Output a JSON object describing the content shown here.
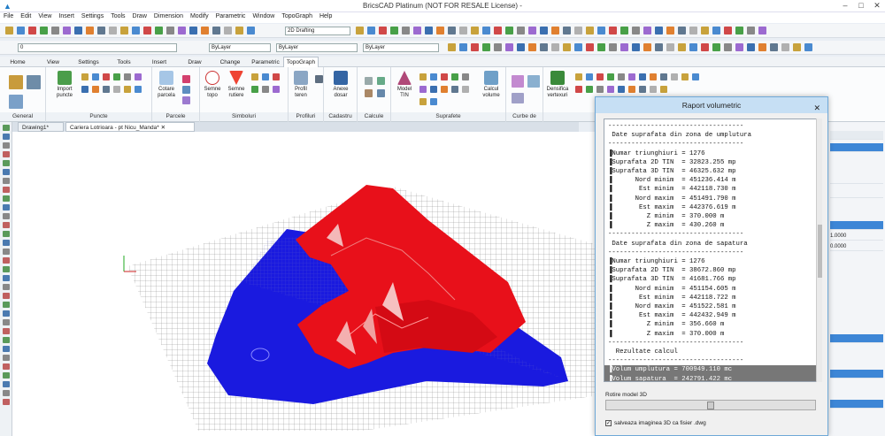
{
  "window": {
    "title": "BricsCAD Platinum (NOT FOR RESALE License) -"
  },
  "menu": [
    "File",
    "Edit",
    "View",
    "Insert",
    "Settings",
    "Tools",
    "Draw",
    "Dimension",
    "Modify",
    "Parametric",
    "Window",
    "TopoGraph",
    "Help"
  ],
  "toolbar": {
    "layer_value": "0",
    "workspace": "2D Drafting",
    "color_value": "ByLayer",
    "linetype_value": "ByLayer",
    "lineweight_value": "ByLayer"
  },
  "ribbon_tabs": [
    "Home",
    "View",
    "Settings",
    "Tools",
    "Insert",
    "Draw",
    "Change",
    "Parametric",
    "TopoGraph"
  ],
  "ribbon_active": "TopoGraph",
  "ribbon": {
    "groups": [
      "General",
      "Puncte",
      "Parcele",
      "Simboluri",
      "Profiluri",
      "Cadastru",
      "Calcule",
      "Suprafete",
      "Curbe de nivel",
      "Polilinii"
    ],
    "buttons": {
      "import_points": "Import puncte",
      "cotare_parcela": "Cotare parcela",
      "semne_topo": "Semne topo",
      "semne_rutiere": "Semne rutiere",
      "profil_teren": "Profil teren",
      "anexe_dosar": "Anexe dosar",
      "model_tin": "Model TIN",
      "calcul_volume": "Calcul volume",
      "densifica_vertexuri": "Densifica vertexuri"
    }
  },
  "doc_tabs": [
    "Drawing1*",
    "Cariera Lotrioara - pt Nicu_Manda*"
  ],
  "right_panel": {
    "values": [
      "1.0000",
      "0.0000"
    ]
  },
  "dialog": {
    "title": "Raport volumetric",
    "report_lines": [
      "-----------------------------------",
      " Date suprafata din zona de umplutura",
      "-----------------------------------",
      "▐Numar triunghiuri = 1276",
      "▐Suprafata 2D TIN  = 32823.255 mp",
      "▐Suprafata 3D TIN  = 46325.632 mp",
      "▐      Nord minim  = 451236.414 m",
      "▐       Est minim  = 442118.730 m",
      "▐      Nord maxim  = 451491.790 m",
      "▐       Est maxim  = 442376.619 m",
      "▐         Z minim  = 370.000 m",
      "▐         Z maxim  = 430.260 m",
      "-----------------------------------",
      " Date suprafata din zona de sapatura",
      "-----------------------------------",
      "▐Numar triunghiuri = 1276",
      "▐Suprafata 2D TIN  = 38672.860 mp",
      "▐Suprafata 3D TIN  = 41681.766 mp",
      "▐      Nord minim  = 451154.605 m",
      "▐       Est minim  = 442118.722 m",
      "▐      Nord maxim  = 451522.581 m",
      "▐       Est maxim  = 442432.949 m",
      "▐         Z minim  = 356.660 m",
      "▐         Z maxim  = 370.000 m",
      "-----------------------------------",
      "  Rezultate calcul",
      "-----------------------------------",
      "▐Volum umplutura = 700949.110 mc",
      "▐Volum sapatura  = 242791.422 mc"
    ],
    "highlight_from": 27,
    "rotate_label": "Rotire model 3D",
    "rotate_value": 0.5,
    "save_checkbox_label": "salveaza imaginea 3D ca fisier .dwg",
    "save_checked": true
  },
  "colors": {
    "fill": "#e8101a",
    "cut": "#1a1adf",
    "grid": "#8c8c8c",
    "accent": "#1e7bc6"
  }
}
